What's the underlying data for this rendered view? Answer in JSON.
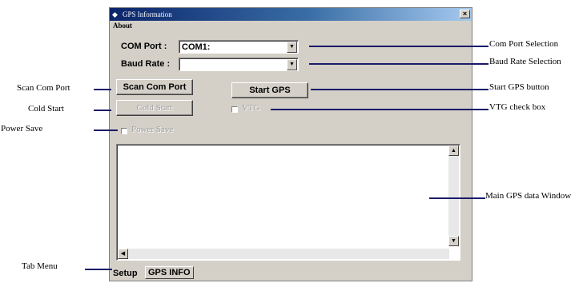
{
  "window": {
    "title": "GPS Information",
    "close_glyph": "×",
    "menu": [
      "About"
    ]
  },
  "setup": {
    "com_port_label": "COM Port :",
    "com_port_value": "COM1:",
    "baud_rate_label": "Baud Rate :",
    "baud_rate_value": "",
    "scan_button": "Scan Com Port",
    "start_button": "Start GPS",
    "cold_start_button": "Cold Start",
    "vtg_label": "VTG",
    "power_save_label": "Power Save"
  },
  "tabs": [
    "Setup",
    "GPS INFO"
  ],
  "annotations": {
    "com_port_selection": "Com Port Selection",
    "baud_rate_selection": "Baud Rate Selection",
    "start_gps_button": "Start GPS button",
    "vtg_check_box": "VTG check box",
    "main_window": "Main GPS data Window",
    "scan_com_port": "Scan Com Port",
    "cold_start": "Cold Start",
    "power_save": "Power Save",
    "tab_menu": "Tab Menu"
  },
  "colors": {
    "titlebar_start": "#0a246a",
    "window_face": "#d4d0c8",
    "annotation_line": "#1a1a6a"
  },
  "icons": {
    "app": "gps-app-icon",
    "dropdown": "chevron-down-icon",
    "scroll_up": "scroll-up-icon",
    "scroll_down": "scroll-down-icon",
    "scroll_left": "scroll-left-icon"
  }
}
